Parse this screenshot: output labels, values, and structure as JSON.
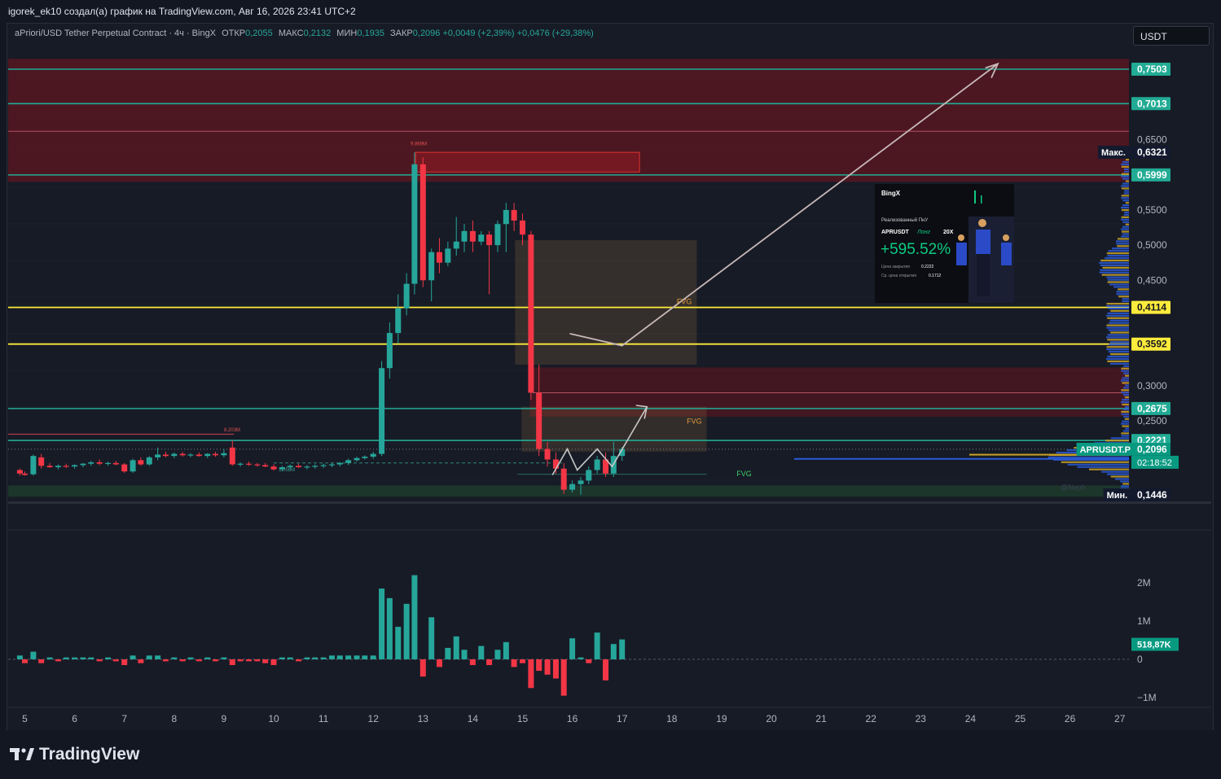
{
  "header": {
    "attribution": "igorek_ek10 создал(а) график на TradingView.com, Авг 16, 2026 23:41 UTC+2"
  },
  "legend": {
    "symbol": "aPriori/USD Tether Perpetual Contract · 4ч · BingX",
    "open_label": "ОТКР",
    "open": "0,2055",
    "high_label": "МАКС",
    "high": "0,2132",
    "low_label": "МИН",
    "low": "0,1935",
    "close_label": "ЗАКР",
    "close": "0,2096",
    "change": "+0,0049 (+2,39%)",
    "change2": "+0,0476 (+29,38%)"
  },
  "currency": "USDT",
  "footer": {
    "brand": "TradingView"
  },
  "pnl_card": {
    "brand": "BingX",
    "title": "Реализованный ПнУ",
    "pair": "APRUSDT",
    "side": "Лонг",
    "leverage": "20X",
    "pnl": "+595.52%",
    "close_label": "Цена закрытия",
    "close_value": "0.2222",
    "open_label": "Ср. цена открытия",
    "open_value": "0.1712"
  },
  "colors": {
    "up": "#26a69a",
    "down": "#f23645",
    "bg": "#171b26",
    "yellow": "#ffeb3b",
    "teal_line": "#22ab94"
  },
  "chart_data": {
    "type": "candlestick",
    "symbol": "APRUSDT.P",
    "timeframe": "4ч",
    "x_ticks": [
      "5",
      "6",
      "7",
      "8",
      "9",
      "10",
      "11",
      "12",
      "13",
      "14",
      "15",
      "16",
      "17",
      "18",
      "19",
      "20",
      "21",
      "22",
      "23",
      "24",
      "25",
      "26",
      "27"
    ],
    "y_ticks": [
      "0,2500",
      "0,3000",
      "0,4500",
      "0,5000",
      "0,5500",
      "0,6500"
    ],
    "ylim": [
      0.13,
      0.78
    ],
    "price_labels": [
      {
        "value": 0.7503,
        "text": "0,7503",
        "color": "#22ab94"
      },
      {
        "value": 0.7013,
        "text": "0,7013",
        "color": "#22ab94"
      },
      {
        "value": 0.6321,
        "text": "0,6321",
        "tag": "Макс.",
        "color": "#2962ff"
      },
      {
        "value": 0.5999,
        "text": "0,5999",
        "color": "#22ab94"
      },
      {
        "value": 0.4114,
        "text": "0,4114",
        "color": "#ffeb3b"
      },
      {
        "value": 0.3592,
        "text": "0,3592",
        "color": "#ffeb3b"
      },
      {
        "value": 0.2675,
        "text": "0,2675",
        "color": "#22ab94"
      },
      {
        "value": 0.2221,
        "text": "0,2221",
        "color": "#22ab94"
      },
      {
        "value": 0.2096,
        "text": "0,2096",
        "tag": "APRUSDT.P",
        "extra": "02:18:52",
        "color": "#089981"
      },
      {
        "value": 0.1446,
        "text": "0,1446",
        "tag": "Мин.",
        "color": "#2962ff"
      }
    ],
    "levels": {
      "teal": [
        0.7503,
        0.7013,
        0.5999,
        0.2675,
        0.2221
      ],
      "yellow": [
        0.4114,
        0.3592
      ]
    },
    "annotations": {
      "fvg": "FVG",
      "vol_high": "9.869M",
      "vol_left": "8.203M",
      "vol_small": "1.058M",
      "watermark": "@Neph"
    },
    "candles": [
      {
        "x": 4.9,
        "o": 0.18,
        "h": 0.182,
        "l": 0.172,
        "c": 0.175
      },
      {
        "x": 5.0,
        "o": 0.175,
        "h": 0.178,
        "l": 0.172,
        "c": 0.173
      },
      {
        "x": 5.17,
        "o": 0.174,
        "h": 0.202,
        "l": 0.172,
        "c": 0.2
      },
      {
        "x": 5.33,
        "o": 0.198,
        "h": 0.203,
        "l": 0.182,
        "c": 0.186
      },
      {
        "x": 5.5,
        "o": 0.186,
        "h": 0.19,
        "l": 0.183,
        "c": 0.184
      },
      {
        "x": 5.67,
        "o": 0.184,
        "h": 0.188,
        "l": 0.181,
        "c": 0.186
      },
      {
        "x": 5.83,
        "o": 0.186,
        "h": 0.189,
        "l": 0.183,
        "c": 0.185
      },
      {
        "x": 6.0,
        "o": 0.185,
        "h": 0.188,
        "l": 0.182,
        "c": 0.187
      },
      {
        "x": 6.17,
        "o": 0.187,
        "h": 0.19,
        "l": 0.184,
        "c": 0.189
      },
      {
        "x": 6.33,
        "o": 0.189,
        "h": 0.193,
        "l": 0.186,
        "c": 0.191
      },
      {
        "x": 6.5,
        "o": 0.191,
        "h": 0.195,
        "l": 0.187,
        "c": 0.189
      },
      {
        "x": 6.67,
        "o": 0.189,
        "h": 0.192,
        "l": 0.186,
        "c": 0.19
      },
      {
        "x": 6.83,
        "o": 0.19,
        "h": 0.193,
        "l": 0.187,
        "c": 0.188
      },
      {
        "x": 7.0,
        "o": 0.188,
        "h": 0.19,
        "l": 0.176,
        "c": 0.178
      },
      {
        "x": 7.17,
        "o": 0.178,
        "h": 0.196,
        "l": 0.176,
        "c": 0.194
      },
      {
        "x": 7.33,
        "o": 0.194,
        "h": 0.198,
        "l": 0.186,
        "c": 0.188
      },
      {
        "x": 7.5,
        "o": 0.188,
        "h": 0.2,
        "l": 0.186,
        "c": 0.198
      },
      {
        "x": 7.67,
        "o": 0.198,
        "h": 0.212,
        "l": 0.194,
        "c": 0.202
      },
      {
        "x": 7.83,
        "o": 0.202,
        "h": 0.206,
        "l": 0.198,
        "c": 0.2
      },
      {
        "x": 8.0,
        "o": 0.2,
        "h": 0.205,
        "l": 0.197,
        "c": 0.203
      },
      {
        "x": 8.17,
        "o": 0.203,
        "h": 0.206,
        "l": 0.199,
        "c": 0.201
      },
      {
        "x": 8.33,
        "o": 0.201,
        "h": 0.204,
        "l": 0.198,
        "c": 0.202
      },
      {
        "x": 8.5,
        "o": 0.202,
        "h": 0.205,
        "l": 0.199,
        "c": 0.2
      },
      {
        "x": 8.67,
        "o": 0.2,
        "h": 0.204,
        "l": 0.197,
        "c": 0.203
      },
      {
        "x": 8.83,
        "o": 0.203,
        "h": 0.206,
        "l": 0.199,
        "c": 0.201
      },
      {
        "x": 9.0,
        "o": 0.201,
        "h": 0.21,
        "l": 0.198,
        "c": 0.204
      },
      {
        "x": 9.17,
        "o": 0.212,
        "h": 0.222,
        "l": 0.186,
        "c": 0.188
      },
      {
        "x": 9.33,
        "o": 0.188,
        "h": 0.191,
        "l": 0.185,
        "c": 0.189
      },
      {
        "x": 9.5,
        "o": 0.189,
        "h": 0.192,
        "l": 0.186,
        "c": 0.188
      },
      {
        "x": 9.67,
        "o": 0.188,
        "h": 0.19,
        "l": 0.185,
        "c": 0.187
      },
      {
        "x": 9.83,
        "o": 0.187,
        "h": 0.19,
        "l": 0.184,
        "c": 0.185
      },
      {
        "x": 10.0,
        "o": 0.185,
        "h": 0.188,
        "l": 0.179,
        "c": 0.181
      },
      {
        "x": 10.17,
        "o": 0.181,
        "h": 0.186,
        "l": 0.178,
        "c": 0.184
      },
      {
        "x": 10.33,
        "o": 0.184,
        "h": 0.188,
        "l": 0.181,
        "c": 0.186
      },
      {
        "x": 10.5,
        "o": 0.186,
        "h": 0.189,
        "l": 0.183,
        "c": 0.184
      },
      {
        "x": 10.67,
        "o": 0.184,
        "h": 0.187,
        "l": 0.181,
        "c": 0.185
      },
      {
        "x": 10.83,
        "o": 0.185,
        "h": 0.188,
        "l": 0.182,
        "c": 0.186
      },
      {
        "x": 11.0,
        "o": 0.186,
        "h": 0.189,
        "l": 0.183,
        "c": 0.187
      },
      {
        "x": 11.17,
        "o": 0.187,
        "h": 0.19,
        "l": 0.184,
        "c": 0.188
      },
      {
        "x": 11.33,
        "o": 0.188,
        "h": 0.191,
        "l": 0.185,
        "c": 0.19
      },
      {
        "x": 11.5,
        "o": 0.19,
        "h": 0.196,
        "l": 0.187,
        "c": 0.194
      },
      {
        "x": 11.67,
        "o": 0.194,
        "h": 0.199,
        "l": 0.192,
        "c": 0.197
      },
      {
        "x": 11.83,
        "o": 0.197,
        "h": 0.201,
        "l": 0.195,
        "c": 0.199
      },
      {
        "x": 12.0,
        "o": 0.199,
        "h": 0.206,
        "l": 0.196,
        "c": 0.203
      },
      {
        "x": 12.17,
        "o": 0.203,
        "h": 0.335,
        "l": 0.2,
        "c": 0.325
      },
      {
        "x": 12.33,
        "o": 0.325,
        "h": 0.39,
        "l": 0.31,
        "c": 0.375
      },
      {
        "x": 12.5,
        "o": 0.375,
        "h": 0.43,
        "l": 0.36,
        "c": 0.41
      },
      {
        "x": 12.67,
        "o": 0.41,
        "h": 0.46,
        "l": 0.4,
        "c": 0.445
      },
      {
        "x": 12.83,
        "o": 0.445,
        "h": 0.632,
        "l": 0.43,
        "c": 0.615
      },
      {
        "x": 13.0,
        "o": 0.615,
        "h": 0.625,
        "l": 0.44,
        "c": 0.45
      },
      {
        "x": 13.17,
        "o": 0.45,
        "h": 0.495,
        "l": 0.42,
        "c": 0.49
      },
      {
        "x": 13.33,
        "o": 0.49,
        "h": 0.51,
        "l": 0.46,
        "c": 0.475
      },
      {
        "x": 13.5,
        "o": 0.475,
        "h": 0.505,
        "l": 0.47,
        "c": 0.495
      },
      {
        "x": 13.67,
        "o": 0.495,
        "h": 0.54,
        "l": 0.485,
        "c": 0.505
      },
      {
        "x": 13.83,
        "o": 0.505,
        "h": 0.53,
        "l": 0.49,
        "c": 0.52
      },
      {
        "x": 14.0,
        "o": 0.52,
        "h": 0.535,
        "l": 0.49,
        "c": 0.505
      },
      {
        "x": 14.17,
        "o": 0.505,
        "h": 0.52,
        "l": 0.5,
        "c": 0.515
      },
      {
        "x": 14.33,
        "o": 0.515,
        "h": 0.52,
        "l": 0.43,
        "c": 0.5
      },
      {
        "x": 14.5,
        "o": 0.5,
        "h": 0.535,
        "l": 0.49,
        "c": 0.53
      },
      {
        "x": 14.67,
        "o": 0.53,
        "h": 0.56,
        "l": 0.49,
        "c": 0.55
      },
      {
        "x": 14.83,
        "o": 0.55,
        "h": 0.56,
        "l": 0.52,
        "c": 0.535
      },
      {
        "x": 15.0,
        "o": 0.535,
        "h": 0.545,
        "l": 0.5,
        "c": 0.515
      },
      {
        "x": 15.17,
        "o": 0.515,
        "h": 0.52,
        "l": 0.28,
        "c": 0.29
      },
      {
        "x": 15.33,
        "o": 0.29,
        "h": 0.33,
        "l": 0.2,
        "c": 0.21
      },
      {
        "x": 15.5,
        "o": 0.21,
        "h": 0.22,
        "l": 0.185,
        "c": 0.195
      },
      {
        "x": 15.67,
        "o": 0.195,
        "h": 0.205,
        "l": 0.175,
        "c": 0.182
      },
      {
        "x": 15.83,
        "o": 0.182,
        "h": 0.19,
        "l": 0.146,
        "c": 0.152
      },
      {
        "x": 16.0,
        "o": 0.152,
        "h": 0.165,
        "l": 0.148,
        "c": 0.16
      },
      {
        "x": 16.17,
        "o": 0.16,
        "h": 0.17,
        "l": 0.145,
        "c": 0.165
      },
      {
        "x": 16.33,
        "o": 0.165,
        "h": 0.185,
        "l": 0.16,
        "c": 0.18
      },
      {
        "x": 16.5,
        "o": 0.18,
        "h": 0.2,
        "l": 0.175,
        "c": 0.195
      },
      {
        "x": 16.67,
        "o": 0.195,
        "h": 0.205,
        "l": 0.17,
        "c": 0.175
      },
      {
        "x": 16.83,
        "o": 0.175,
        "h": 0.22,
        "l": 0.17,
        "c": 0.2
      },
      {
        "x": 17.0,
        "o": 0.2,
        "h": 0.213,
        "l": 0.193,
        "c": 0.21
      }
    ],
    "volume": {
      "y_ticks": [
        "2M",
        "1M",
        "0",
        "−1M"
      ],
      "last": "518,87K",
      "bars": [
        {
          "x": 4.9,
          "v": 0.1
        },
        {
          "x": 5.0,
          "v": -0.1
        },
        {
          "x": 5.17,
          "v": 0.2
        },
        {
          "x": 5.33,
          "v": -0.1
        },
        {
          "x": 5.5,
          "v": 0.05
        },
        {
          "x": 5.67,
          "v": -0.05
        },
        {
          "x": 5.83,
          "v": 0.05
        },
        {
          "x": 6.0,
          "v": 0.05
        },
        {
          "x": 6.17,
          "v": 0.05
        },
        {
          "x": 6.33,
          "v": 0.05
        },
        {
          "x": 6.5,
          "v": -0.05
        },
        {
          "x": 6.67,
          "v": 0.05
        },
        {
          "x": 6.83,
          "v": -0.05
        },
        {
          "x": 7.0,
          "v": -0.15
        },
        {
          "x": 7.17,
          "v": 0.1
        },
        {
          "x": 7.33,
          "v": -0.1
        },
        {
          "x": 7.5,
          "v": 0.1
        },
        {
          "x": 7.67,
          "v": 0.1
        },
        {
          "x": 7.83,
          "v": -0.05
        },
        {
          "x": 8.0,
          "v": 0.05
        },
        {
          "x": 8.17,
          "v": -0.05
        },
        {
          "x": 8.33,
          "v": 0.05
        },
        {
          "x": 8.5,
          "v": -0.05
        },
        {
          "x": 8.67,
          "v": 0.05
        },
        {
          "x": 8.83,
          "v": -0.05
        },
        {
          "x": 9.0,
          "v": 0.05
        },
        {
          "x": 9.17,
          "v": -0.15
        },
        {
          "x": 9.33,
          "v": -0.05
        },
        {
          "x": 9.5,
          "v": -0.05
        },
        {
          "x": 9.67,
          "v": -0.05
        },
        {
          "x": 9.83,
          "v": -0.1
        },
        {
          "x": 10.0,
          "v": -0.15
        },
        {
          "x": 10.17,
          "v": 0.05
        },
        {
          "x": 10.33,
          "v": 0.05
        },
        {
          "x": 10.5,
          "v": -0.05
        },
        {
          "x": 10.67,
          "v": 0.05
        },
        {
          "x": 10.83,
          "v": 0.05
        },
        {
          "x": 11.0,
          "v": 0.05
        },
        {
          "x": 11.17,
          "v": 0.1
        },
        {
          "x": 11.33,
          "v": 0.1
        },
        {
          "x": 11.5,
          "v": 0.1
        },
        {
          "x": 11.67,
          "v": 0.1
        },
        {
          "x": 11.83,
          "v": 0.1
        },
        {
          "x": 12.0,
          "v": 0.1
        },
        {
          "x": 12.17,
          "v": 1.85
        },
        {
          "x": 12.33,
          "v": 1.6
        },
        {
          "x": 12.5,
          "v": 0.85
        },
        {
          "x": 12.67,
          "v": 1.45
        },
        {
          "x": 12.83,
          "v": 2.2
        },
        {
          "x": 13.0,
          "v": -0.45
        },
        {
          "x": 13.17,
          "v": 1.1
        },
        {
          "x": 13.33,
          "v": -0.2
        },
        {
          "x": 13.5,
          "v": 0.3
        },
        {
          "x": 13.67,
          "v": 0.6
        },
        {
          "x": 13.83,
          "v": 0.25
        },
        {
          "x": 14.0,
          "v": -0.15
        },
        {
          "x": 14.17,
          "v": 0.35
        },
        {
          "x": 14.33,
          "v": -0.15
        },
        {
          "x": 14.5,
          "v": 0.25
        },
        {
          "x": 14.67,
          "v": 0.45
        },
        {
          "x": 14.83,
          "v": -0.2
        },
        {
          "x": 15.0,
          "v": -0.1
        },
        {
          "x": 15.17,
          "v": -0.75
        },
        {
          "x": 15.33,
          "v": -0.3
        },
        {
          "x": 15.5,
          "v": -0.4
        },
        {
          "x": 15.67,
          "v": -0.5
        },
        {
          "x": 15.83,
          "v": -0.95
        },
        {
          "x": 16.0,
          "v": 0.55
        },
        {
          "x": 16.17,
          "v": 0.05
        },
        {
          "x": 16.33,
          "v": -0.1
        },
        {
          "x": 16.5,
          "v": 0.7
        },
        {
          "x": 16.67,
          "v": -0.55
        },
        {
          "x": 16.83,
          "v": 0.4
        },
        {
          "x": 17.0,
          "v": 0.52
        }
      ]
    }
  }
}
